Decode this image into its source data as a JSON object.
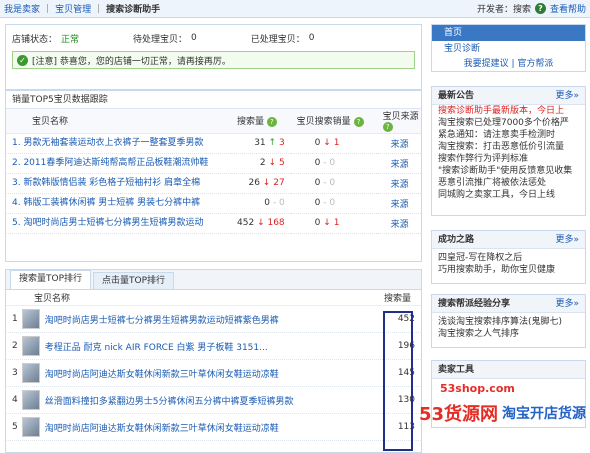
{
  "topbar": {
    "crumbs": [
      "我是卖家",
      "宝贝管理"
    ],
    "current": "搜索诊断助手",
    "developer_label": "开发者：搜索",
    "help_label": "查看帮助"
  },
  "status": {
    "store_label": "店铺状态：",
    "store_value": "正常",
    "pending_label": "待处理宝贝：",
    "pending_value": "0",
    "processed_label": "已处理宝贝：",
    "processed_value": "0",
    "notice": "[注意] 恭喜您，您的店铺一切正常，请再接再厉。"
  },
  "top5": {
    "title": "销量TOP5宝贝数据跟踪",
    "columns": [
      "宝贝名称",
      "搜索量",
      "宝贝搜索销量",
      "宝贝来源"
    ],
    "rows": [
      {
        "name": "1. 男款无袖套装运动衣上衣裤子一整套夏季男款",
        "search": "31",
        "s_dir": "↑",
        "s_delta": "3",
        "sales": "0",
        "sales_dir": "↓",
        "sales_delta": "1",
        "source": "来源"
      },
      {
        "name": "2. 2011春季阿迪达斯纯帮高帮正品板鞋潮流帅鞋",
        "search": "2",
        "s_dir": "↓",
        "s_delta": "5",
        "sales": "0",
        "sales_dir": "-",
        "sales_delta": "0",
        "source": "来源"
      },
      {
        "name": "3. 新款韩版情侣装 彩色格子短袖衬衫 肩章全棉",
        "search": "26",
        "s_dir": "↓",
        "s_delta": "27",
        "sales": "0",
        "sales_dir": "-",
        "sales_delta": "0",
        "source": "来源"
      },
      {
        "name": "4. 韩版工装裤休闲裤 男士短裤 男装七分裤中裤",
        "search": "0",
        "s_dir": "-",
        "s_delta": "0",
        "sales": "0",
        "sales_dir": "-",
        "sales_delta": "0",
        "source": "来源"
      },
      {
        "name": "5. 淘吧时尚店男士短裤七分裤男生短裤男款运动",
        "search": "452",
        "s_dir": "↓",
        "s_delta": "168",
        "sales": "0",
        "sales_dir": "↓",
        "sales_delta": "1",
        "source": "来源"
      }
    ]
  },
  "rank": {
    "tabs": [
      "搜索量TOP排行",
      "点击量TOP排行"
    ],
    "col_name": "宝贝名称",
    "col_value": "搜索量",
    "rows": [
      {
        "name": "淘吧时尚店男士短裤七分裤男生短裤男款运动短裤紫色男裤",
        "value": "452"
      },
      {
        "name": "考程正品 耐克 nick AIR FORCE 白紫 男子板鞋 3151...",
        "value": "196"
      },
      {
        "name": "淘吧时尚店阿迪达斯女鞋休闲新款三叶草休闲女鞋运动凉鞋",
        "value": "145"
      },
      {
        "name": "丝滑面料撞扣多紧翻边男士5分裤休闲五分裤中裤夏季短裤男款",
        "value": "130"
      },
      {
        "name": "淘吧时尚店阿迪达斯女鞋休闲新款三叶草休闲女鞋运动凉鞋",
        "value": "113"
      }
    ]
  },
  "sidebar": {
    "nav_home": "首页",
    "nav_item": "宝贝诊断",
    "nav_links": "我要提建议 | 官方帮派",
    "news": {
      "title": "最新公告",
      "more": "更多»",
      "items": [
        "搜索诊断助手最新版本，今日上",
        "淘宝搜索已处理7000多个价格严",
        "紧急通知：请注意卖手检测时",
        "淘宝搜索：打击恶意低价引流量",
        "搜索作弊行为评判标准",
        "\"搜索诊断助手\"使用反馈意见收集",
        "恶意引流推广将被依法惩处",
        "同城购之卖家工具，今日上线"
      ]
    },
    "success": {
      "title": "成功之路",
      "more": "更多»",
      "items": [
        "四皇冠-写在降权之后",
        "巧用搜索助手，助你宝贝健康"
      ]
    },
    "share": {
      "title": "搜索帮派经验分享",
      "more": "更多»",
      "items": [
        "浅谈淘宝搜索排序算法(鬼脚七)",
        "淘宝搜索之人气排序"
      ]
    },
    "tools": {
      "title": "卖家工具"
    }
  },
  "watermark": {
    "a": "53货源网",
    "b": "淘宝开店货源",
    "c": "53shop.com"
  },
  "colors": {
    "accent": "#3b78c3",
    "up": "#2e9a2e",
    "down": "#d22222",
    "highlight_box": "#1f2f8a"
  }
}
